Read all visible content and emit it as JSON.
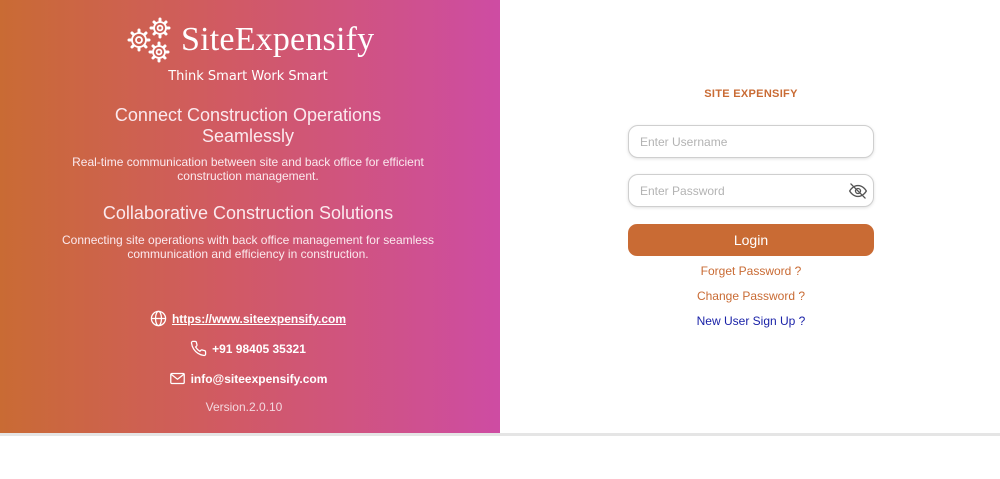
{
  "brand": {
    "name": "SiteExpensify",
    "tagline": "Think Smart Work Smart"
  },
  "hero": {
    "heading_1": "Connect Construction Operations Seamlessly",
    "text_1": "Real-time communication between site and back office for efficient construction management.",
    "heading_2": "Collaborative Construction Solutions",
    "text_2": "Connecting site operations with back office management for seamless communication and efficiency in construction."
  },
  "contact": {
    "website": "https://www.siteexpensify.com",
    "phone": "+91 98405 35321",
    "email": "info@siteexpensify.com",
    "version": "Version.2.0.10"
  },
  "login": {
    "title": "SITE EXPENSIFY",
    "username_placeholder": "Enter Username",
    "username_value": "",
    "password_placeholder": "Enter Password",
    "password_value": "",
    "login_label": "Login",
    "forget_password": "Forget Password ?",
    "change_password": "Change Password ?",
    "signup": "New User Sign Up ?"
  },
  "colors": {
    "accent": "#c96b34",
    "gradient_start": "#c96b34",
    "gradient_end": "#ce4ca3",
    "signup_link": "#1a22a8"
  },
  "icons": {
    "logo": "gears-icon",
    "website": "globe-icon",
    "phone": "phone-icon",
    "email": "mail-icon",
    "password_toggle": "eye-slash-icon"
  }
}
